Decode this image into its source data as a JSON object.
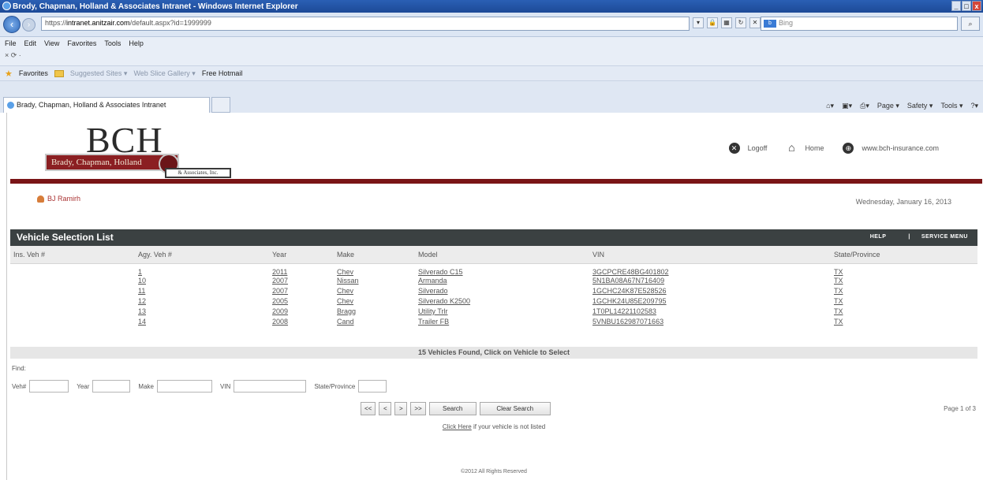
{
  "browser": {
    "window_title": "Brody, Chapman, Holland & Associates Intranet - Windows Internet Explorer",
    "url_prefix": "https://",
    "url_host": "intranet.anitzair.com",
    "url_rest": "/default.aspx?id=1999999",
    "search_placeholder": "Bing",
    "menu": [
      "File",
      "Edit",
      "View",
      "Favorites",
      "Tools",
      "Help"
    ],
    "favorites_label": "Favorites",
    "fav_items": [
      "Suggested Sites ▾",
      "Web Slice Gallery ▾",
      "Free Hotmail"
    ],
    "tab_title": "Brady, Chapman, Holland & Associates Intranet",
    "command_items": [
      "Page ▾",
      "Safety ▾",
      "Tools ▾"
    ]
  },
  "header": {
    "logo_text": "BCH",
    "logo_banner": "Brady, Chapman, Holland",
    "logo_sub": "& Associates, Inc.",
    "logoff_label": "Logoff",
    "home_label": "Home",
    "site_label": "www.bch-insurance.com"
  },
  "user_name": "BJ Ramirh",
  "date": "Wednesday, January 16, 2013",
  "panel": {
    "title": "Vehicle Selection List",
    "help_label": "HELP",
    "service_menu_label": "SERVICE MENU"
  },
  "table": {
    "headers": [
      "Ins. Veh #",
      "Agy. Veh #",
      "Year",
      "Make",
      "Model",
      "VIN",
      "State/Province"
    ],
    "rows": [
      {
        "ins": "",
        "agy": "1",
        "year": "2011",
        "make": "Chev",
        "model": "Silverado C15",
        "vin": "3GCPCRE48BG401802",
        "state": "TX"
      },
      {
        "ins": "",
        "agy": "10",
        "year": "2007",
        "make": "Nissan",
        "model": "Armanda",
        "vin": "5N1BA08A67N716409",
        "state": "TX"
      },
      {
        "ins": "",
        "agy": "11",
        "year": "2007",
        "make": "Chev",
        "model": "Silverado",
        "vin": "1GCHC24K87E528526",
        "state": "TX"
      },
      {
        "ins": "",
        "agy": "12",
        "year": "2005",
        "make": "Chev",
        "model": "Silverado K2500",
        "vin": "1GCHK24U85E209795",
        "state": "TX"
      },
      {
        "ins": "",
        "agy": "13",
        "year": "2009",
        "make": "Bragg",
        "model": "Utility Trlr",
        "vin": "1T0PL14221102583",
        "state": "TX"
      },
      {
        "ins": "",
        "agy": "14",
        "year": "2008",
        "make": "Cand",
        "model": "Trailer FB",
        "vin": "5VNBU162987071663",
        "state": "TX"
      }
    ]
  },
  "found_text": "15 Vehicles Found, Click on Vehicle to Select",
  "find": {
    "label": "Find:",
    "fields": [
      {
        "label": "Veh#",
        "value": ""
      },
      {
        "label": "Year",
        "value": ""
      },
      {
        "label": "Make",
        "value": ""
      },
      {
        "label": "VIN",
        "value": ""
      },
      {
        "label": "State/Province",
        "value": ""
      }
    ]
  },
  "pager": {
    "first": "<<",
    "prev": "<",
    "next": ">",
    "last": ">>",
    "search": "Search",
    "clear": "Clear Search",
    "page_text": "Page  1  of  3"
  },
  "click_here_link": "Click Here",
  "click_here_text": " if your vehicle is not listed",
  "copyright": "©2012 All Rights Reserved",
  "colors": {
    "brand_red": "#7a1517",
    "panel_header": "#3b4142"
  }
}
